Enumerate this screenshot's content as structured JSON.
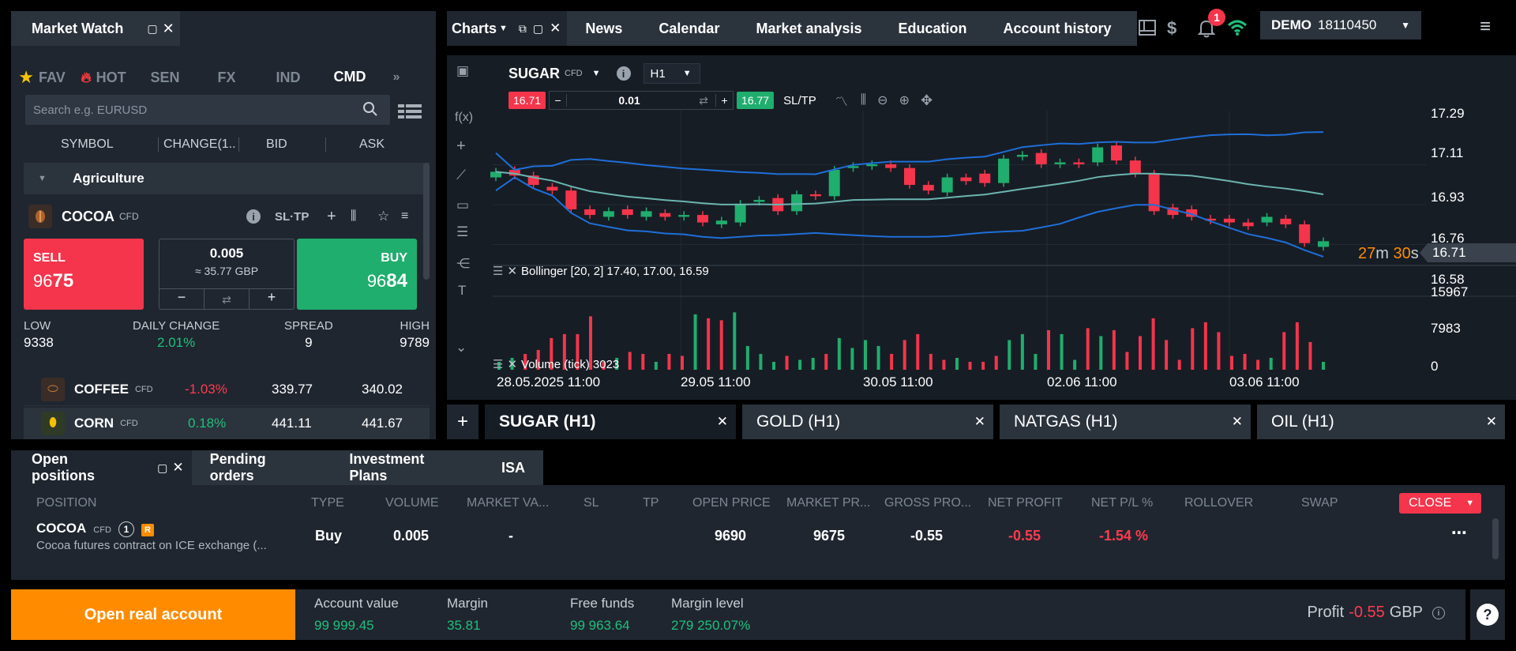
{
  "market_watch": {
    "title": "Market Watch",
    "tabs": [
      "FAV",
      "HOT",
      "SEN",
      "FX",
      "IND",
      "CMD"
    ],
    "active_tab": "CMD",
    "search_placeholder": "Search e.g. EURUSD",
    "columns": [
      "SYMBOL",
      "CHANGE(1..",
      "BID",
      "ASK"
    ],
    "group": "Agriculture",
    "selected": {
      "symbol": "COCOA",
      "type": "CFD",
      "sltp": "SL·TP",
      "sell_label": "SELL",
      "sell_price_small": "96",
      "sell_price_big": "75",
      "buy_label": "BUY",
      "buy_price_small": "96",
      "buy_price_big": "84",
      "volume": "0.005",
      "volume_value": "≈ 35.77 GBP",
      "low_label": "LOW",
      "low": "9338",
      "daily_change_label": "DAILY CHANGE",
      "daily_change": "2.01%",
      "spread_label": "SPREAD",
      "spread": "9",
      "high_label": "HIGH",
      "high": "9789"
    },
    "rows": [
      {
        "symbol": "COFFEE",
        "type": "CFD",
        "change": "-1.03%",
        "bid": "339.77",
        "ask": "340.02",
        "up": false
      },
      {
        "symbol": "CORN",
        "type": "CFD",
        "change": "0.18%",
        "bid": "441.11",
        "ask": "441.67",
        "up": true
      }
    ]
  },
  "charts": {
    "tab_label": "Charts",
    "nav": [
      "News",
      "Calendar",
      "Market analysis",
      "Education",
      "Account history"
    ],
    "notifications": "1",
    "account_type": "DEMO",
    "account_number": "18110450",
    "symbol": "SUGAR",
    "symbol_type": "CFD",
    "timeframe": "H1",
    "sell_price": "16.71",
    "buy_price": "16.77",
    "volume": "0.01",
    "sltp": "SL/TP",
    "fx_label": "f(x)",
    "bollinger_label": "Bollinger [20, 2] 17.40, 17.00, 16.59",
    "volume_label": "Volume (tick) 3023",
    "countdown_min": "27",
    "countdown_m": "m",
    "countdown_sec": "30",
    "countdown_s": "s",
    "price_axis": [
      "17.29",
      "17.11",
      "16.93",
      "16.76",
      "16.58"
    ],
    "current_price": "16.71",
    "volume_axis": [
      "15967",
      "7983",
      "0"
    ],
    "time_axis": [
      "28.05.2025 11:00",
      "29.05 11:00",
      "30.05 11:00",
      "02.06 11:00",
      "03.06 11:00"
    ],
    "bottom_tabs": [
      "SUGAR (H1)",
      "GOLD (H1)",
      "NATGAS (H1)",
      "OIL (H1)"
    ]
  },
  "chart_data": {
    "type": "candlestick",
    "symbol": "SUGAR",
    "timeframe": "H1",
    "ylim": [
      16.5,
      17.35
    ],
    "candles": [
      {
        "o": 17.07,
        "c": 17.1
      },
      {
        "o": 17.11,
        "c": 17.08
      },
      {
        "o": 17.08,
        "c": 17.03
      },
      {
        "o": 17.02,
        "c": 17.0
      },
      {
        "o": 17.0,
        "c": 16.9
      },
      {
        "o": 16.9,
        "c": 16.87
      },
      {
        "o": 16.86,
        "c": 16.89
      },
      {
        "o": 16.9,
        "c": 16.87
      },
      {
        "o": 16.86,
        "c": 16.89
      },
      {
        "o": 16.88,
        "c": 16.86
      },
      {
        "o": 16.86,
        "c": 16.87
      },
      {
        "o": 16.87,
        "c": 16.83
      },
      {
        "o": 16.82,
        "c": 16.84
      },
      {
        "o": 16.83,
        "c": 16.93
      },
      {
        "o": 16.94,
        "c": 16.95
      },
      {
        "o": 16.96,
        "c": 16.89
      },
      {
        "o": 16.89,
        "c": 16.98
      },
      {
        "o": 16.98,
        "c": 16.97
      },
      {
        "o": 16.97,
        "c": 17.11
      },
      {
        "o": 17.12,
        "c": 17.13
      },
      {
        "o": 17.13,
        "c": 17.14
      },
      {
        "o": 17.14,
        "c": 17.12
      },
      {
        "o": 17.12,
        "c": 17.03
      },
      {
        "o": 17.03,
        "c": 17.0
      },
      {
        "o": 16.99,
        "c": 17.07
      },
      {
        "o": 17.07,
        "c": 17.05
      },
      {
        "o": 17.09,
        "c": 17.04
      },
      {
        "o": 17.04,
        "c": 17.17
      },
      {
        "o": 17.18,
        "c": 17.19
      },
      {
        "o": 17.2,
        "c": 17.14
      },
      {
        "o": 17.14,
        "c": 17.15
      },
      {
        "o": 17.15,
        "c": 17.14
      },
      {
        "o": 17.15,
        "c": 17.23
      },
      {
        "o": 17.24,
        "c": 17.16
      },
      {
        "o": 17.16,
        "c": 17.09
      },
      {
        "o": 17.09,
        "c": 16.89
      },
      {
        "o": 16.91,
        "c": 16.87
      },
      {
        "o": 16.9,
        "c": 16.86
      },
      {
        "o": 16.85,
        "c": 16.84
      },
      {
        "o": 16.85,
        "c": 16.83
      },
      {
        "o": 16.83,
        "c": 16.81
      },
      {
        "o": 16.83,
        "c": 16.86
      },
      {
        "o": 16.85,
        "c": 16.82
      },
      {
        "o": 16.82,
        "c": 16.72
      },
      {
        "o": 16.7,
        "c": 16.73
      }
    ],
    "volume": [
      2000,
      3000,
      4000,
      5000,
      8000,
      9000,
      9000,
      13500,
      2000,
      3000,
      4500,
      4000,
      2000,
      4000,
      3500,
      14000,
      13000,
      12500,
      14500,
      6000,
      4000,
      2000,
      3500,
      2500,
      3000,
      4000,
      8000,
      5500,
      7500,
      6000,
      4000,
      7500,
      9000,
      4000,
      2500,
      3000,
      2000,
      2000,
      3500,
      7500,
      9000,
      4000,
      10000,
      9000,
      2500,
      10500,
      8500,
      10000,
      4500,
      8500,
      13000,
      7500,
      2500,
      10500,
      12000,
      9500,
      3500,
      4000,
      2500,
      3000,
      9500,
      12000,
      7000,
      2000
    ],
    "volume_ylim": [
      0,
      15967
    ]
  },
  "positions": {
    "tabs": [
      "Open positions",
      "Pending orders",
      "Investment Plans",
      "ISA"
    ],
    "columns": [
      "POSITION",
      "TYPE",
      "VOLUME",
      "MARKET VA...",
      "SL",
      "TP",
      "OPEN PRICE",
      "MARKET PR...",
      "GROSS PRO...",
      "NET PROFIT",
      "NET P/L %",
      "ROLLOVER",
      "SWAP"
    ],
    "close_label": "CLOSE",
    "row": {
      "symbol": "COCOA",
      "type_badge": "CFD",
      "count": "1",
      "r_badge": "R",
      "description": "Cocoa futures contract on ICE exchange (...",
      "type": "Buy",
      "volume": "0.005",
      "market_value": "-",
      "open_price": "9690",
      "market_price": "9675",
      "gross_profit": "-0.55",
      "net_profit": "-0.55",
      "net_pl": "-1.54 %"
    }
  },
  "footer": {
    "open_real": "Open real account",
    "account_value_label": "Account value",
    "account_value": "99 999.45",
    "margin_label": "Margin",
    "margin": "35.81",
    "free_funds_label": "Free funds",
    "free_funds": "99 963.64",
    "margin_level_label": "Margin level",
    "margin_level": "279 250.07%",
    "profit_label": "Profit",
    "profit_value": "-0.55",
    "profit_currency": "GBP"
  },
  "colors": {
    "up": "#1fae6d",
    "down": "#f4354b",
    "accent_orange": "#ff8c00",
    "band_blue": "#1e6fd9",
    "band_mid": "#6bb5b0"
  }
}
